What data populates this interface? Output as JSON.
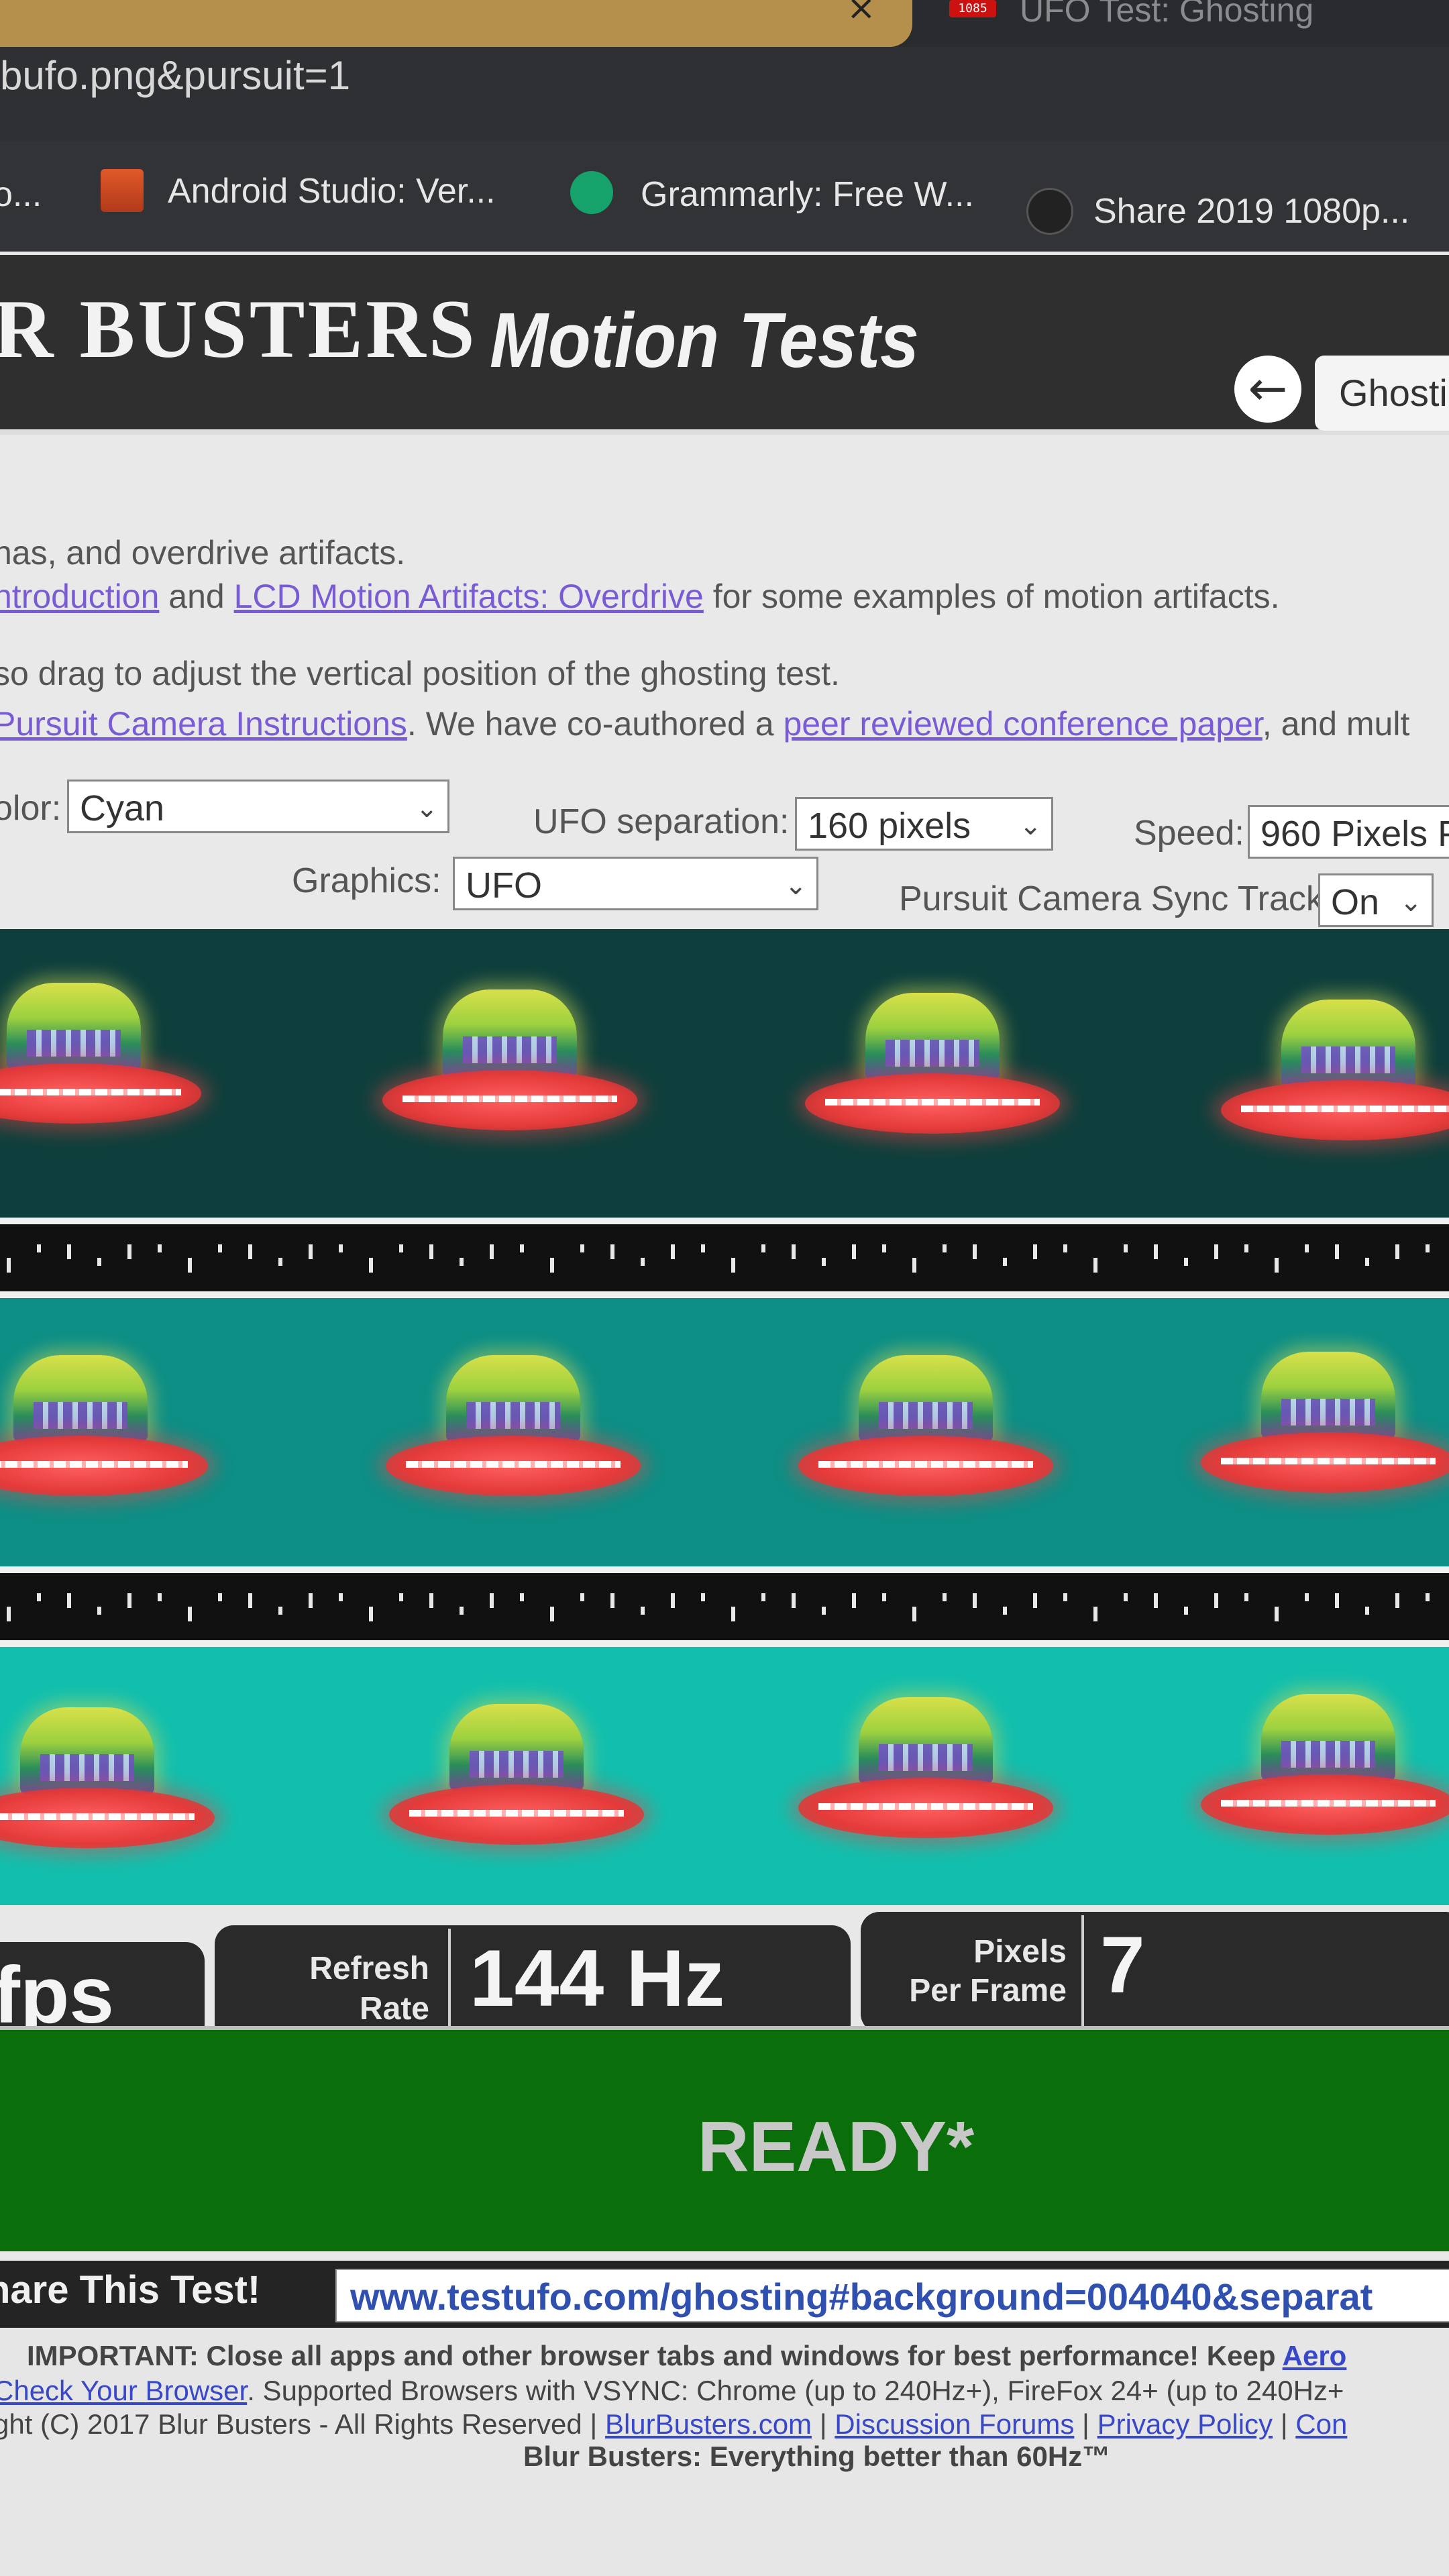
{
  "browser": {
    "tab_close": "×",
    "right_tab_favicon": "1085",
    "right_tab_title": "UFO Test: Ghosting",
    "address": "bufo.png&pursuit=1",
    "bookmarks": [
      {
        "label": "o...",
        "icon": "page-icon"
      },
      {
        "label": "Android Studio: Ver...",
        "icon": "stackoverflow-icon"
      },
      {
        "label": "Grammarly: Free W...",
        "icon": "grammarly-icon"
      },
      {
        "label": "Share 2019 1080p...",
        "icon": "film-reel-icon"
      }
    ]
  },
  "header": {
    "title_main": "R BUSTERS",
    "title_sub": "Motion Tests",
    "back_symbol": "←",
    "test_select": "Ghosti"
  },
  "info": {
    "line1": "nas, and overdrive artifacts.",
    "line2_link1": "ntroduction",
    "line2_mid": " and ",
    "line2_link2": "LCD Motion Artifacts: Overdrive",
    "line2_end": " for some examples of motion artifacts.",
    "line3": "so drag to adjust the vertical position of the ghosting test.",
    "line4_link1": "Pursuit Camera Instructions",
    "line4_mid": ". We have co-authored a ",
    "line4_link2": "peer reviewed conference paper",
    "line4_end": ", and mult"
  },
  "controls": {
    "color_label": "olor:",
    "color_value": "Cyan",
    "separation_label": "UFO separation:",
    "separation_value": "160 pixels",
    "speed_label": "Speed:",
    "speed_value": "960 Pixels P",
    "graphics_label": "Graphics:",
    "graphics_value": "UFO",
    "sync_label": "Pursuit Camera Sync Track:",
    "sync_value": "On",
    "chevron": "⌄"
  },
  "lanes": [
    {
      "color": "#0f3f3c"
    },
    {
      "color": "#0d8f86"
    },
    {
      "color": "#12bfae"
    }
  ],
  "stats": {
    "fps_suffix": "fps",
    "refresh_label_1": "Refresh",
    "refresh_label_2": "Rate",
    "refresh_value": "144 Hz",
    "ppf_label_1": "Pixels",
    "ppf_label_2": "Per Frame",
    "ppf_value": "7"
  },
  "status": {
    "ready": "READY*"
  },
  "share": {
    "label": "hare This Test!",
    "url": "www.testufo.com/ghosting#background=004040&separat"
  },
  "footer": {
    "important_bold": "IMPORTANT: Close all apps and other browser tabs and windows for best performance! Keep ",
    "important_link": "Aero",
    "line2_link": "Check Your Browser",
    "line2_text": ". Supported Browsers with VSYNC: Chrome (up to 240Hz+), FireFox 24+ (up to 240Hz+",
    "line3_text": "ght (C) 2017 Blur Busters - All Rights Reserved | ",
    "line3_link1": "BlurBusters.com",
    "line3_sep1": " | ",
    "line3_link2": "Discussion Forums",
    "line3_sep2": " | ",
    "line3_link3": "Privacy Policy",
    "line3_sep3": " | ",
    "line3_link4": "Con",
    "tagline": "Blur Busters: Everything better than 60Hz™"
  }
}
